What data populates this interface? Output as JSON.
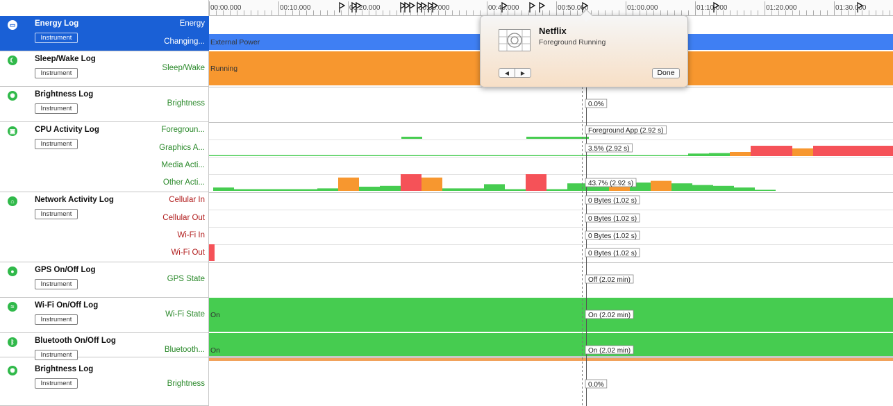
{
  "colors": {
    "selected": "#1a60d6",
    "blue_bar": "#3f7ff3",
    "orange": "#f7972f",
    "green": "#46cc50",
    "red": "#f55258",
    "track_green": "#2c8a2c",
    "track_red": "#b22020"
  },
  "ruler": {
    "ticks": [
      "00:00.000",
      "00:10.000",
      "00:20.000",
      "00:30.000",
      "00:40.000",
      "00:50.000",
      "01:00.000",
      "01:10.000",
      "01:20.000",
      "01:30.000"
    ]
  },
  "instruments": [
    {
      "name": "Energy Log",
      "badge": "Instrument",
      "icon": "battery-icon",
      "selected": true,
      "tracks": [
        "Energy",
        "Changing..."
      ]
    },
    {
      "name": "Sleep/Wake Log",
      "badge": "Instrument",
      "icon": "moon-icon",
      "tracks": [
        "Sleep/Wake"
      ]
    },
    {
      "name": "Brightness Log",
      "badge": "Instrument",
      "icon": "sun-icon",
      "tracks": [
        "Brightness"
      ]
    },
    {
      "name": "CPU Activity Log",
      "badge": "Instrument",
      "icon": "cpu-icon",
      "tracks": [
        "Foregroun...",
        "Graphics A...",
        "Media Acti...",
        "Other Acti..."
      ]
    },
    {
      "name": "Network Activity Log",
      "badge": "Instrument",
      "icon": "antenna-icon",
      "tracks": [
        "Cellular In",
        "Cellular Out",
        "Wi-Fi In",
        "Wi-Fi Out"
      ]
    },
    {
      "name": "GPS On/Off Log",
      "badge": "Instrument",
      "icon": "location-pin-icon",
      "tracks": [
        "GPS State"
      ]
    },
    {
      "name": "Wi-Fi On/Off Log",
      "badge": "Instrument",
      "icon": "wifi-icon",
      "tracks": [
        "Wi-Fi State"
      ]
    },
    {
      "name": "Bluetooth On/Off Log",
      "badge": "Instrument",
      "icon": "bluetooth-icon",
      "tracks": [
        "Bluetooth..."
      ]
    },
    {
      "name": "Brightness Log",
      "badge": "Instrument",
      "icon": "sun-icon",
      "tracks": [
        "Brightness"
      ]
    }
  ],
  "bar_labels": {
    "energy": "External Power",
    "sleep": "Running",
    "wifi": "On",
    "bluetooth": "On"
  },
  "inspection_labels": {
    "brightness": "0.0%",
    "foreground": "Foreground App (2.92 s)",
    "graphics": "3.5% (2.92 s)",
    "other": "43.7% (2.92 s)",
    "cell_in": "0 Bytes (1.02 s)",
    "cell_out": "0 Bytes (1.02 s)",
    "wifi_in": "0 Bytes (1.02 s)",
    "wifi_out": "0 Bytes (1.02 s)",
    "gps": "Off (2.02 min)",
    "wifi_state": "On (2.02 min)",
    "bt_state": "On (2.02 min)",
    "brightness2": "0.0%"
  },
  "popover": {
    "title": "Netflix",
    "subtitle": "Foreground Running",
    "prev_icon": "triangle-left-icon",
    "next_icon": "triangle-right-icon",
    "done_label": "Done"
  },
  "cpu_other_levels": [
    [
      "green",
      0.2
    ],
    [
      "green",
      0.1
    ],
    [
      "green",
      0.1
    ],
    [
      "green",
      0.1
    ],
    [
      "green",
      0.1
    ],
    [
      "green",
      0.15
    ],
    [
      "orange",
      0.8
    ],
    [
      "green",
      0.25
    ],
    [
      "green",
      0.3
    ],
    [
      "red",
      1.0
    ],
    [
      "orange",
      0.8
    ],
    [
      "green",
      0.15
    ],
    [
      "green",
      0.15
    ],
    [
      "green",
      0.4
    ],
    [
      "green",
      0.1
    ],
    [
      "red",
      1.0
    ],
    [
      "green",
      0.1
    ],
    [
      "green",
      0.45
    ],
    [
      "green",
      0.45
    ],
    [
      "orange",
      0.3
    ],
    [
      "green",
      0.5
    ],
    [
      "orange",
      0.6
    ],
    [
      "green",
      0.45
    ],
    [
      "green",
      0.35
    ],
    [
      "green",
      0.3
    ],
    [
      "green",
      0.2
    ],
    [
      "green",
      0.05
    ]
  ],
  "cpu_graphics_levels": [
    [
      "green",
      0.1
    ],
    [
      "green",
      0.1
    ],
    [
      "green",
      0.1
    ],
    [
      "green",
      0.1
    ],
    [
      "green",
      0.1
    ],
    [
      "green",
      0.1
    ],
    [
      "green",
      0.1
    ],
    [
      "green",
      0.1
    ],
    [
      "green",
      0.1
    ],
    [
      "green",
      0.1
    ],
    [
      "green",
      0.1
    ],
    [
      "green",
      0.1
    ],
    [
      "green",
      0.1
    ],
    [
      "green",
      0.1
    ],
    [
      "green",
      0.1
    ],
    [
      "green",
      0.1
    ],
    [
      "green",
      0.1
    ],
    [
      "green",
      0.1
    ],
    [
      "green",
      0.1
    ],
    [
      "green",
      0.1
    ],
    [
      "green",
      0.1
    ],
    [
      "green",
      0.1
    ],
    [
      "green",
      0.1
    ],
    [
      "green",
      0.25
    ],
    [
      "green",
      0.3
    ],
    [
      "orange",
      0.4
    ],
    [
      "red",
      1.0
    ],
    [
      "red",
      1.0
    ],
    [
      "orange",
      0.75
    ],
    [
      "red",
      1.0
    ],
    [
      "red",
      1.0
    ],
    [
      "red",
      1.0
    ],
    [
      "red",
      1.0
    ]
  ]
}
